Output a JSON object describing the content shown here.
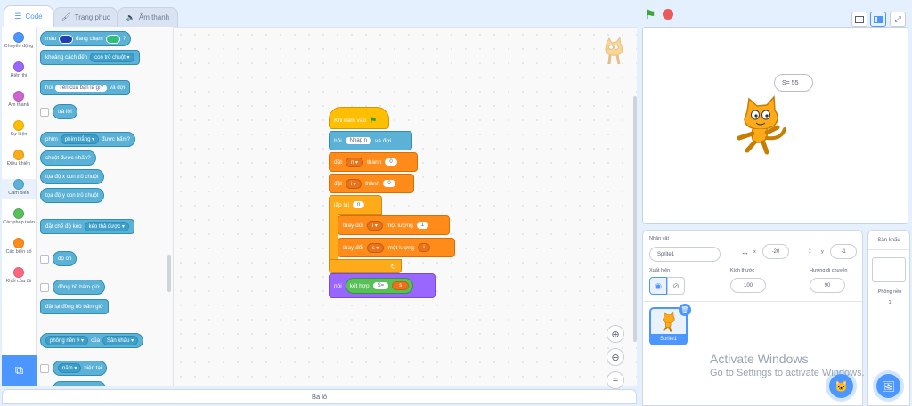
{
  "tabs": {
    "code": "Code",
    "costumes": "Trang phục",
    "sounds": "Âm thanh"
  },
  "categories": [
    {
      "label": "Chuyển động",
      "color": "#4c97ff"
    },
    {
      "label": "Hiển thị",
      "color": "#9966ff"
    },
    {
      "label": "Âm thanh",
      "color": "#cf63cf"
    },
    {
      "label": "Sự kiện",
      "color": "#ffbf00"
    },
    {
      "label": "Điều khiển",
      "color": "#ffab19"
    },
    {
      "label": "Cảm biến",
      "color": "#5cb1d6"
    },
    {
      "label": "Các phép toán",
      "color": "#59c059"
    },
    {
      "label": "Các biến số",
      "color": "#ff8c1a"
    },
    {
      "label": "Khối của tôi",
      "color": "#ff6680"
    }
  ],
  "palette": {
    "touching_color_a": "màu",
    "touching_color_b": "đang chạm",
    "touching_color_c": "?",
    "distance_to": "khoảng cách đến",
    "mouse_pointer": "con trỏ chuột",
    "ask": "hỏi",
    "ask_default": "Tên của bạn là gì?",
    "and_wait": "và đợi",
    "answer": "trả lời",
    "key": "phím",
    "space": "phím trắng",
    "pressed": "được bấm?",
    "mouse_down": "chuột được nhấn?",
    "mouse_x": "tọa độ x con trỏ chuột",
    "mouse_y": "tọa độ y con trỏ chuột",
    "set_drag": "đặt chế độ kéo",
    "draggable": "kéo thả được",
    "loudness": "độ ồn",
    "timer": "đồng hồ bấm giờ",
    "reset_timer": "đặt lại đồng hồ bấm giờ",
    "backdrop_num": "phông nền #",
    "of": "của",
    "stage": "Sân khấu",
    "year": "năm",
    "current": "hiện tại"
  },
  "script": {
    "when_clicked": "Khi bấm vào",
    "ask": "hỏi",
    "ask_value": "Nhap n",
    "and_wait": "và đợi",
    "set": "đặt",
    "to": "thành",
    "var_n": "n",
    "var_i": "i",
    "var_s": "s",
    "zero1": "0",
    "zero2": "0",
    "repeat": "lặp lại",
    "change": "thay đổi",
    "by": "một lượng",
    "one": "1",
    "say": "nói",
    "join": "kết hợp",
    "join_text": "S="
  },
  "stage": {
    "bubble": "S= 55"
  },
  "sprite": {
    "label": "Nhân vật",
    "name": "Sprite1",
    "x_label": "x",
    "x": "-20",
    "y_label": "y",
    "y": "-1",
    "show_label": "Xuất hiện",
    "size_label": "Kích thước",
    "size": "100",
    "direction_label": "Hướng di chuyển",
    "direction": "90",
    "thumb_name": "Sprite1"
  },
  "stage_panel": {
    "title": "Sân khấu",
    "backdrops_label": "Phông nền",
    "backdrops": "1"
  },
  "backpack": "Ba lô",
  "watermark": {
    "line1": "Activate Windows",
    "line2": "Go to Settings to activate Windows."
  },
  "colors": {
    "accent": "#4c97ff",
    "sensing": "#5cb1d6",
    "variables": "#ff8c1a",
    "control": "#ffab19",
    "events": "#ffbf00",
    "looks": "#9966ff",
    "operators": "#59c059"
  }
}
